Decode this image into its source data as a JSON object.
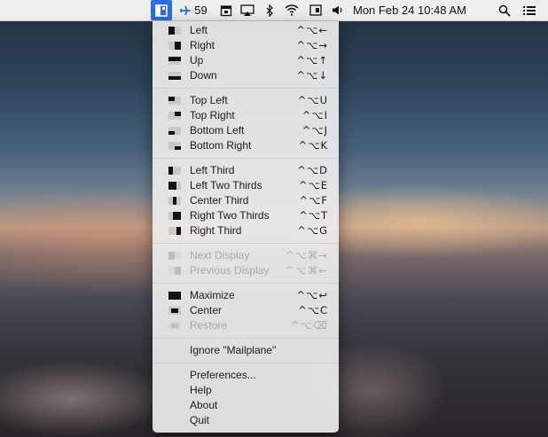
{
  "menubar": {
    "flight_badge": "59",
    "clock": "Mon Feb 24  10:48 AM",
    "icons": [
      "rectangle-app-icon",
      "airplane-icon",
      "calendar-icon",
      "airplay-icon",
      "bluetooth-icon",
      "wifi-icon",
      "display-icon",
      "volume-icon",
      "search-icon",
      "list-icon"
    ]
  },
  "menu": {
    "groups": [
      [
        {
          "label": "Left",
          "shortcut": "^⌥←",
          "icon": "left-half",
          "enabled": true
        },
        {
          "label": "Right",
          "shortcut": "^⌥→",
          "icon": "right-half",
          "enabled": true
        },
        {
          "label": "Up",
          "shortcut": "^⌥↑",
          "icon": "top-half",
          "enabled": true
        },
        {
          "label": "Down",
          "shortcut": "^⌥↓",
          "icon": "bottom-half",
          "enabled": true
        }
      ],
      [
        {
          "label": "Top Left",
          "shortcut": "^⌥U",
          "icon": "top-left",
          "enabled": true
        },
        {
          "label": "Top Right",
          "shortcut": "^⌥I",
          "icon": "top-right",
          "enabled": true
        },
        {
          "label": "Bottom Left",
          "shortcut": "^⌥J",
          "icon": "bottom-left",
          "enabled": true
        },
        {
          "label": "Bottom Right",
          "shortcut": "^⌥K",
          "icon": "bottom-right",
          "enabled": true
        }
      ],
      [
        {
          "label": "Left Third",
          "shortcut": "^⌥D",
          "icon": "left-third",
          "enabled": true
        },
        {
          "label": "Left Two Thirds",
          "shortcut": "^⌥E",
          "icon": "left-two-thirds",
          "enabled": true
        },
        {
          "label": "Center Third",
          "shortcut": "^⌥F",
          "icon": "center-third",
          "enabled": true
        },
        {
          "label": "Right Two Thirds",
          "shortcut": "^⌥T",
          "icon": "right-two-thirds",
          "enabled": true
        },
        {
          "label": "Right Third",
          "shortcut": "^⌥G",
          "icon": "right-third",
          "enabled": true
        }
      ],
      [
        {
          "label": "Next Display",
          "shortcut": "^⌥⌘→",
          "icon": "next-display",
          "enabled": false
        },
        {
          "label": "Previous Display",
          "shortcut": "^⌥⌘←",
          "icon": "previous-display",
          "enabled": false
        }
      ],
      [
        {
          "label": "Maximize",
          "shortcut": "^⌥↩",
          "icon": "maximize",
          "enabled": true
        },
        {
          "label": "Center",
          "shortcut": "^⌥C",
          "icon": "center",
          "enabled": true
        },
        {
          "label": "Restore",
          "shortcut": "^⌥⌫",
          "icon": "restore",
          "enabled": false
        }
      ],
      [
        {
          "label": "Ignore \"Mailplane\"",
          "shortcut": "",
          "icon": "",
          "enabled": true
        }
      ],
      [
        {
          "label": "Preferences...",
          "shortcut": "",
          "icon": "",
          "enabled": true
        },
        {
          "label": "Help",
          "shortcut": "",
          "icon": "",
          "enabled": true
        },
        {
          "label": "About",
          "shortcut": "",
          "icon": "",
          "enabled": true
        },
        {
          "label": "Quit",
          "shortcut": "",
          "icon": "",
          "enabled": true
        }
      ]
    ]
  }
}
